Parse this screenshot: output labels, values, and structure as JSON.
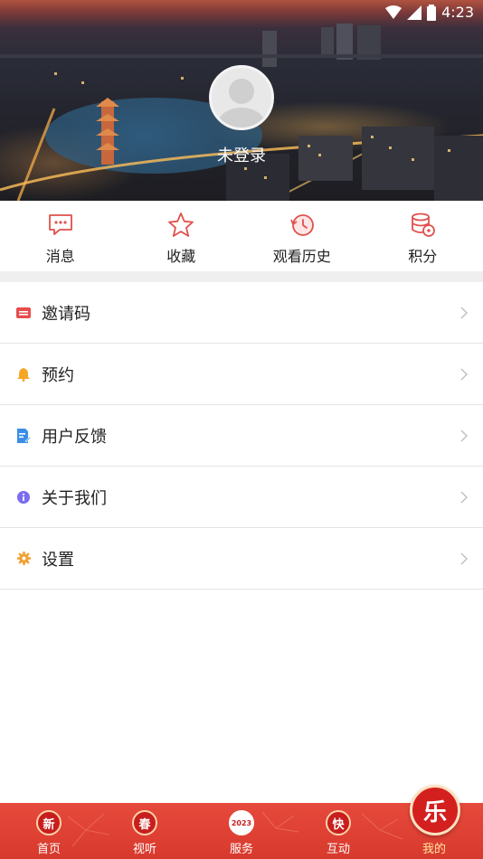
{
  "status_bar": {
    "time": "4:23"
  },
  "profile": {
    "login_status": "未登录"
  },
  "quick_actions": [
    {
      "label": "消息",
      "icon": "message-icon"
    },
    {
      "label": "收藏",
      "icon": "star-icon"
    },
    {
      "label": "观看历史",
      "icon": "history-icon"
    },
    {
      "label": "积分",
      "icon": "points-icon"
    }
  ],
  "menu": [
    {
      "label": "邀请码",
      "icon": "ticket-icon",
      "color": "#e84c4c"
    },
    {
      "label": "预约",
      "icon": "bell-icon",
      "color": "#f5a623"
    },
    {
      "label": "用户反馈",
      "icon": "feedback-icon",
      "color": "#3a8ee6"
    },
    {
      "label": "关于我们",
      "icon": "info-icon",
      "color": "#7b6cf0"
    },
    {
      "label": "设置",
      "icon": "gear-icon",
      "color": "#f0a030"
    }
  ],
  "tabbar": {
    "tabs": [
      {
        "label": "首页",
        "badge": "新"
      },
      {
        "label": "视听",
        "badge": "春"
      },
      {
        "label": "服务",
        "badge": "2023"
      },
      {
        "label": "互动",
        "badge": "快"
      },
      {
        "label": "我的",
        "badge": "乐"
      }
    ],
    "active_index": 4,
    "accent": "#d8392d"
  }
}
